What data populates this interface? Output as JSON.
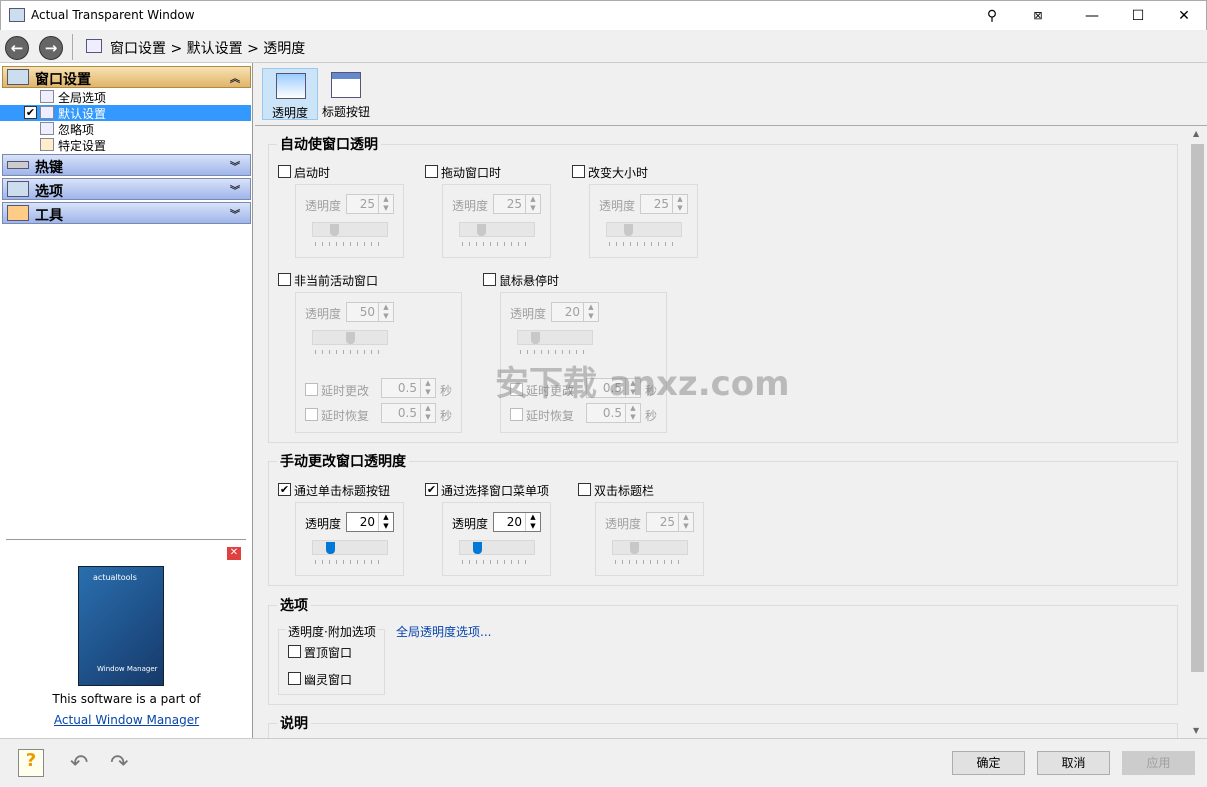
{
  "window": {
    "title": "Actual Transparent Window",
    "controls": [
      "pin-icon",
      "stay-on-top-icon",
      "minimize-icon",
      "maximize-icon",
      "close-icon"
    ]
  },
  "breadcrumb": "窗口设置 > 默认设置 > 透明度",
  "sidebar": {
    "sections": [
      {
        "label": "窗口设置",
        "icon": "window-settings-icon",
        "expanded": true
      },
      {
        "label": "热键",
        "icon": "keyboard-icon",
        "expanded": false
      },
      {
        "label": "选项",
        "icon": "options-icon",
        "expanded": false
      },
      {
        "label": "工具",
        "icon": "tools-icon",
        "expanded": false
      }
    ],
    "items": [
      {
        "label": "全局选项",
        "icon": "global-options-icon"
      },
      {
        "label": "默认设置",
        "icon": "default-settings-icon",
        "selected": true,
        "checked": true
      },
      {
        "label": "忽略项",
        "icon": "exclusions-icon"
      },
      {
        "label": "特定设置",
        "icon": "specific-settings-icon"
      }
    ],
    "promo": {
      "text": "This software is a part of",
      "link": "Actual Window Manager",
      "box_title": "Actual Window Manager",
      "brand": "actualtools"
    }
  },
  "tabs": [
    {
      "label": "透明度",
      "selected": true
    },
    {
      "label": "标题按钮"
    }
  ],
  "groups": {
    "auto": {
      "title": "自动使窗口透明",
      "items": [
        {
          "label": "启动时",
          "checked": false,
          "field": "透明度",
          "value": 25
        },
        {
          "label": "拖动窗口时",
          "checked": false,
          "field": "透明度",
          "value": 25
        },
        {
          "label": "改变大小时",
          "checked": false,
          "field": "透明度",
          "value": 25
        },
        {
          "label": "非当前活动窗口",
          "checked": false,
          "field": "透明度",
          "value": 50,
          "delay_change": "延时更改",
          "delay_change_value": "0.5",
          "delay_restore": "延时恢复",
          "delay_restore_value": "0.5",
          "unit": "秒"
        },
        {
          "label": "鼠标悬停时",
          "checked": false,
          "field": "透明度",
          "value": 20,
          "delay_change": "延时更改",
          "delay_change_value": "0.5",
          "delay_restore": "延时恢复",
          "delay_restore_value": "0.5",
          "unit": "秒"
        }
      ]
    },
    "manual": {
      "title": "手动更改窗口透明度",
      "items": [
        {
          "label": "通过单击标题按钮",
          "checked": true,
          "field": "透明度",
          "value": 20
        },
        {
          "label": "通过选择窗口菜单项",
          "checked": true,
          "field": "透明度",
          "value": 20
        },
        {
          "label": "双击标题栏",
          "checked": false,
          "field": "透明度",
          "value": 25
        }
      ]
    },
    "options": {
      "title": "选项",
      "sub_title": "透明度·附加选项",
      "link": "全局透明度选项...",
      "items": [
        {
          "label": "置顶窗口",
          "checked": false
        },
        {
          "label": "幽灵窗口",
          "checked": false
        }
      ]
    },
    "desc": {
      "title": "说明"
    }
  },
  "watermark": "安下载 anxz.com",
  "buttons": {
    "ok": "确定",
    "cancel": "取消",
    "apply": "应用"
  },
  "bottom_icons": [
    "help-icon",
    "undo-icon",
    "redo-icon"
  ]
}
